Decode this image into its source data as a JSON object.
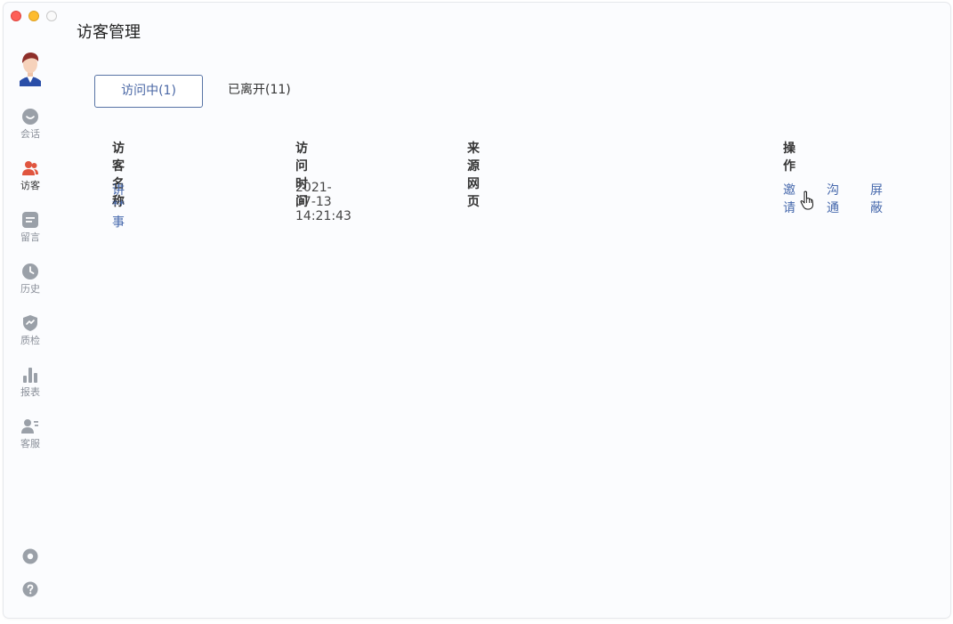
{
  "window": {
    "title": "访客管理"
  },
  "sidebar": {
    "items": [
      {
        "label": "会话",
        "icon": "chat-bubble-icon"
      },
      {
        "label": "访客",
        "icon": "visitors-icon",
        "active": true
      },
      {
        "label": "留言",
        "icon": "message-note-icon"
      },
      {
        "label": "历史",
        "icon": "clock-icon"
      },
      {
        "label": "质检",
        "icon": "shield-check-icon"
      },
      {
        "label": "报表",
        "icon": "bar-chart-icon"
      },
      {
        "label": "客服",
        "icon": "agent-list-icon"
      }
    ],
    "bottom_icons": [
      "settings-icon",
      "help-icon"
    ]
  },
  "tabs": [
    {
      "label": "访问中(1)",
      "active": true
    },
    {
      "label": "已离开(11)",
      "active": false
    }
  ],
  "table": {
    "columns": [
      "访客名称",
      "访问时间",
      "来源网页",
      "操作"
    ],
    "rows": [
      {
        "name": "讲**事",
        "time": "2021-07-13 14:21:43",
        "source": "–",
        "actions": [
          "邀请",
          "沟通",
          "屏蔽"
        ]
      }
    ]
  },
  "colors": {
    "accent": "#4668ac",
    "active_nav": "#e0553f",
    "nav_icon": "#9aa0a8"
  }
}
